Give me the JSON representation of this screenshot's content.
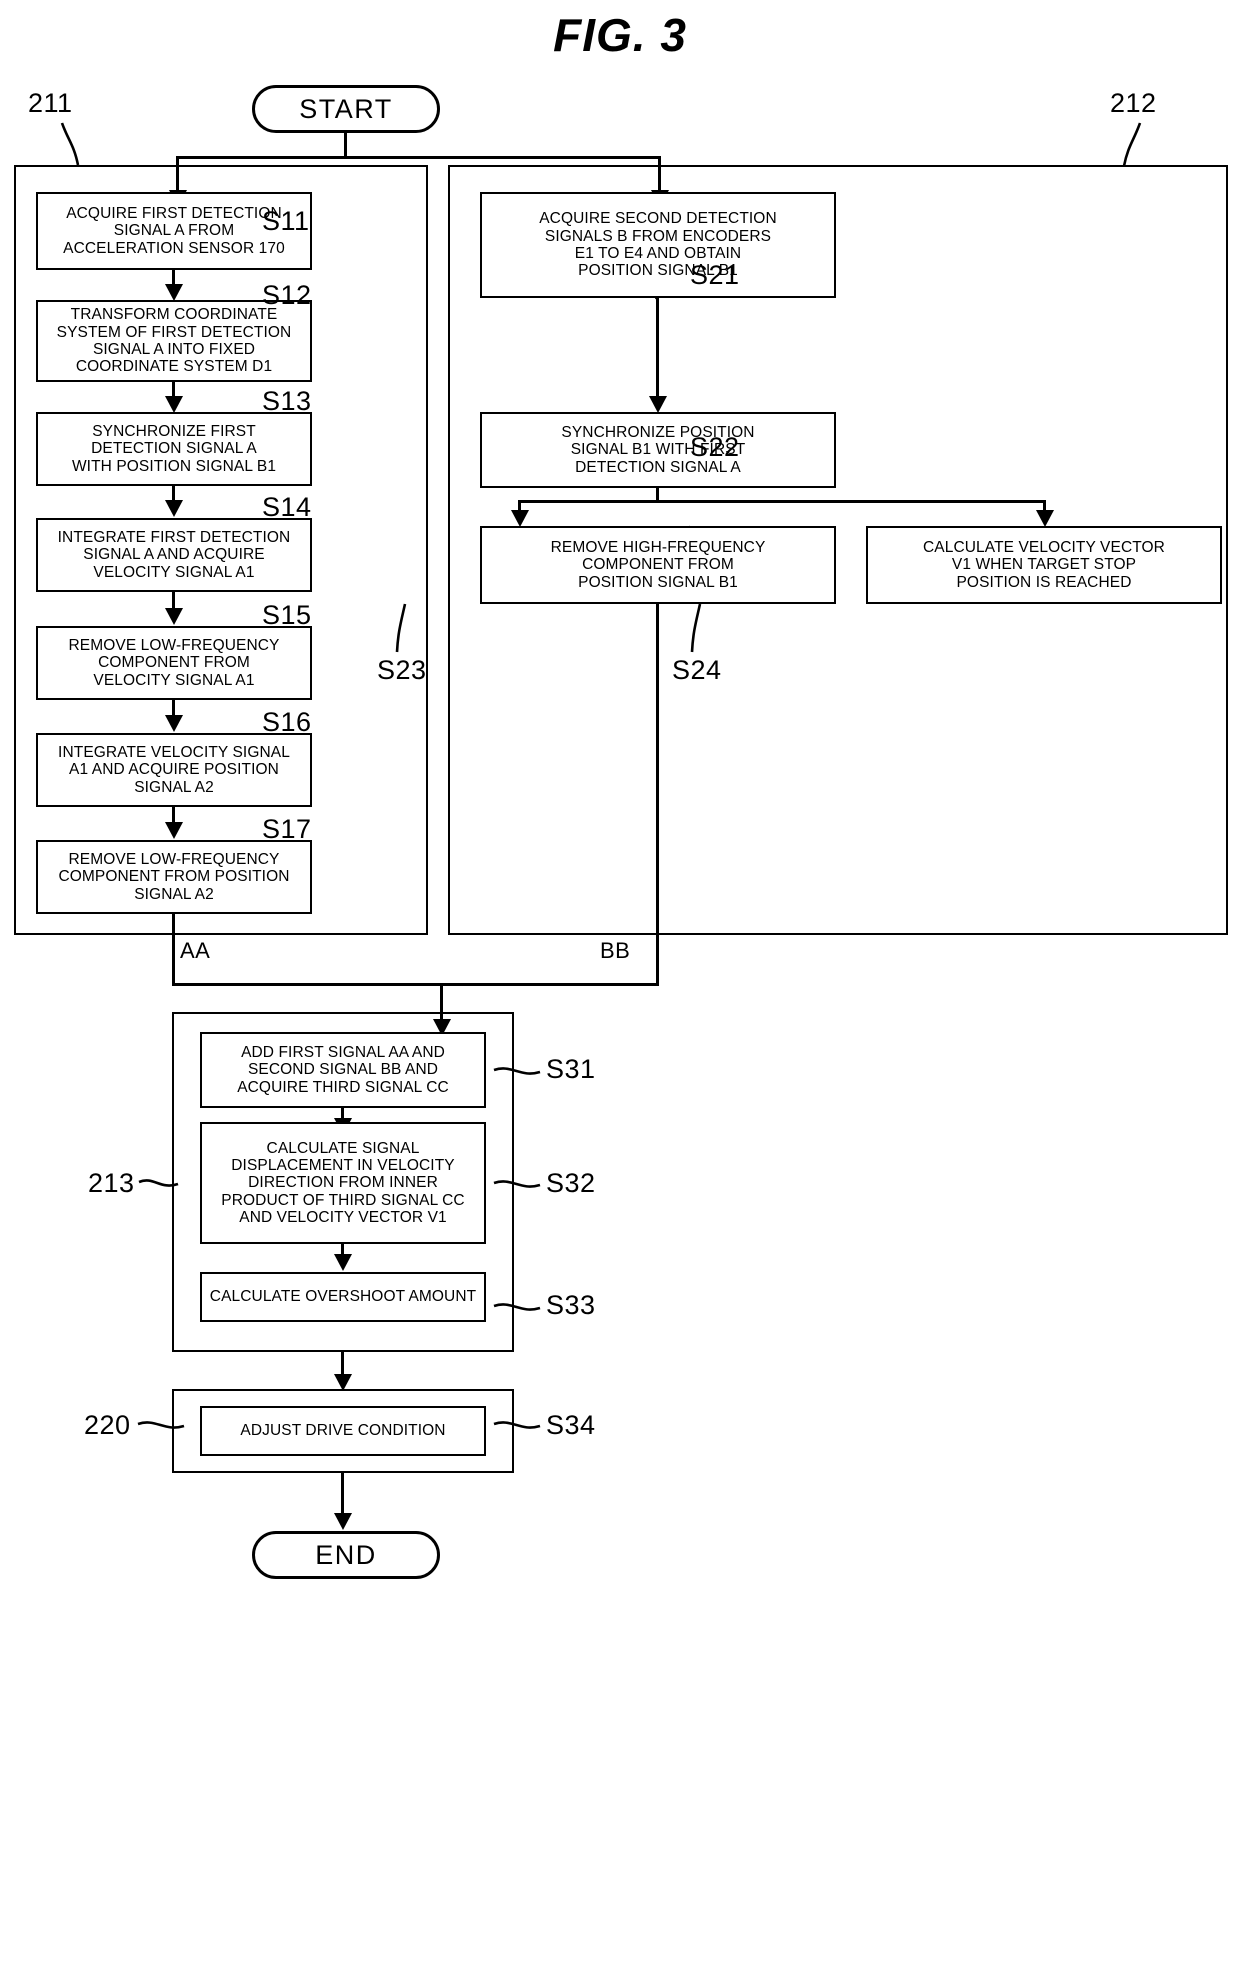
{
  "figure": {
    "title": "FIG. 3"
  },
  "terminators": {
    "start": "START",
    "end": "END"
  },
  "groups": [
    {
      "id": "211",
      "ref": "211"
    },
    {
      "id": "212",
      "ref": "212"
    },
    {
      "id": "213",
      "ref": "213"
    },
    {
      "id": "220",
      "ref": "220"
    }
  ],
  "connectors": {
    "aa": "AA",
    "bb": "BB"
  },
  "steps": {
    "s11": {
      "id": "S11",
      "lines": [
        "ACQUIRE FIRST DETECTION",
        "SIGNAL A FROM",
        "ACCELERATION SENSOR 170"
      ]
    },
    "s12": {
      "id": "S12",
      "lines": [
        "TRANSFORM COORDINATE",
        "SYSTEM OF FIRST DETECTION",
        "SIGNAL A INTO FIXED",
        "COORDINATE SYSTEM D1"
      ]
    },
    "s13": {
      "id": "S13",
      "lines": [
        "SYNCHRONIZE FIRST",
        "DETECTION SIGNAL A",
        "WITH POSITION SIGNAL B1"
      ]
    },
    "s14": {
      "id": "S14",
      "lines": [
        "INTEGRATE FIRST DETECTION",
        "SIGNAL A AND ACQUIRE",
        "VELOCITY SIGNAL A1"
      ]
    },
    "s15": {
      "id": "S15",
      "lines": [
        "REMOVE LOW-FREQUENCY",
        "COMPONENT FROM",
        "VELOCITY SIGNAL A1"
      ]
    },
    "s16": {
      "id": "S16",
      "lines": [
        "INTEGRATE VELOCITY SIGNAL",
        "A1 AND ACQUIRE POSITION",
        "SIGNAL A2"
      ]
    },
    "s17": {
      "id": "S17",
      "lines": [
        "REMOVE LOW-FREQUENCY",
        "COMPONENT FROM POSITION",
        "SIGNAL A2"
      ]
    },
    "s21": {
      "id": "S21",
      "lines": [
        "ACQUIRE SECOND DETECTION",
        "SIGNALS B FROM ENCODERS",
        "E1 TO E4 AND OBTAIN",
        "POSITION SIGNAL B1"
      ]
    },
    "s22": {
      "id": "S22",
      "lines": [
        "SYNCHRONIZE POSITION",
        "SIGNAL B1 WITH FIRST",
        "DETECTION SIGNAL A"
      ]
    },
    "s23": {
      "id": "S23",
      "lines": [
        "REMOVE HIGH-FREQUENCY",
        "COMPONENT FROM",
        "POSITION SIGNAL B1"
      ]
    },
    "s24": {
      "id": "S24",
      "lines": [
        "CALCULATE VELOCITY VECTOR",
        "V1 WHEN TARGET STOP",
        "POSITION IS REACHED"
      ]
    },
    "s31": {
      "id": "S31",
      "lines": [
        "ADD FIRST SIGNAL AA AND",
        "SECOND SIGNAL BB AND",
        "ACQUIRE THIRD SIGNAL CC"
      ]
    },
    "s32": {
      "id": "S32",
      "lines": [
        "CALCULATE SIGNAL",
        "DISPLACEMENT IN VELOCITY",
        "DIRECTION FROM INNER",
        "PRODUCT OF THIRD SIGNAL CC",
        "AND VELOCITY VECTOR V1"
      ]
    },
    "s33": {
      "id": "S33",
      "lines": [
        "CALCULATE OVERSHOOT AMOUNT"
      ]
    },
    "s34": {
      "id": "S34",
      "lines": [
        "ADJUST DRIVE CONDITION"
      ]
    }
  },
  "colors": {
    "stroke": "#000000",
    "background": "#ffffff"
  }
}
